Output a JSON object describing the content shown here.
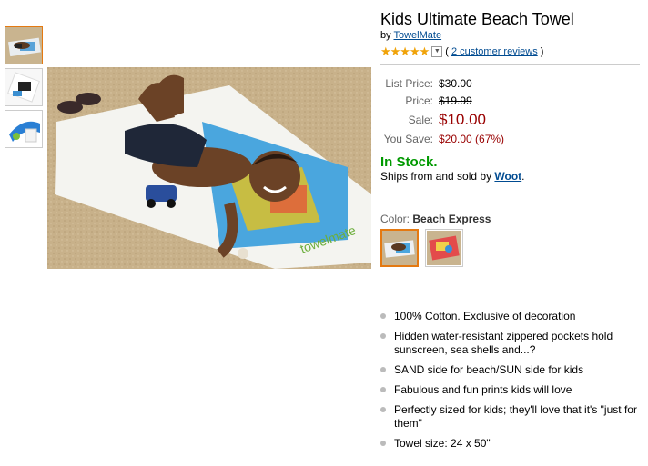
{
  "product": {
    "title": "Kids Ultimate Beach Towel",
    "by_prefix": "by",
    "brand": "TowelMate",
    "stars": "★★★★★",
    "reviews_link": "2 customer reviews",
    "rating_value": 5
  },
  "pricing": {
    "list_label": "List Price:",
    "list_value": "$30.00",
    "price_label": "Price:",
    "price_value": "$19.99",
    "sale_label": "Sale:",
    "sale_value": "$10.00",
    "save_label": "You Save:",
    "save_value": "$20.00 (67%)"
  },
  "availability": {
    "stock": "In Stock.",
    "ships_prefix": "Ships from and sold by",
    "seller": "Woot",
    "ships_suffix": "."
  },
  "color": {
    "label": "Color:",
    "value": "Beach Express"
  },
  "bullets": [
    "100% Cotton. Exclusive of decoration",
    "Hidden water-resistant zippered pockets hold sunscreen, sea shells and...?",
    "SAND side for beach/SUN side for kids",
    "Fabulous and fun prints kids will love",
    "Perfectly sized for kids; they'll love that it's \"just for them\"",
    "Towel size: 24 x 50\""
  ],
  "colors": {
    "accent_orange": "#e47911",
    "price_red": "#990000",
    "stock_green": "#009900",
    "link_blue": "#004b91"
  }
}
